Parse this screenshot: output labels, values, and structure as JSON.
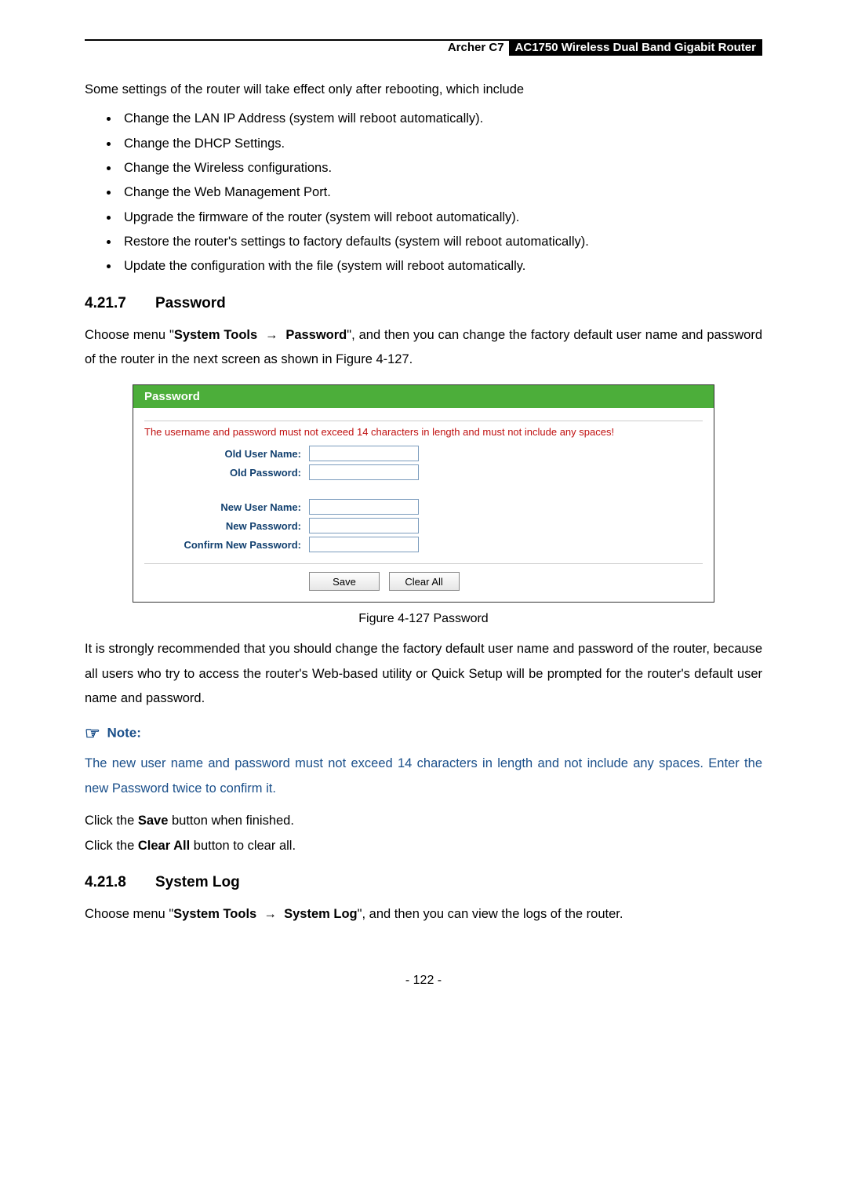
{
  "header": {
    "model": "Archer C7",
    "desc": "AC1750 Wireless Dual Band Gigabit Router"
  },
  "intro": "Some settings of the router will take effect only after rebooting, which include",
  "bullets": [
    "Change the LAN IP Address (system will reboot automatically).",
    "Change the DHCP Settings.",
    "Change the Wireless configurations.",
    "Change the Web Management Port.",
    "Upgrade the firmware of the router (system will reboot automatically).",
    "Restore the router's settings to factory defaults (system will reboot automatically).",
    "Update the configuration with the file (system will reboot automatically."
  ],
  "section1": {
    "num": "4.21.7",
    "title": "Password",
    "para_pre": "Choose menu \"",
    "para_bold1": "System Tools",
    "para_bold2": "Password",
    "para_post": "\", and then you can change the factory default user name and password of the router in the next screen as shown in Figure 4-127."
  },
  "figure": {
    "titlebar": "Password",
    "warning": "The username and password must not exceed 14 characters in length and must not include any spaces!",
    "labels": {
      "old_user": "Old User Name:",
      "old_pass": "Old Password:",
      "new_user": "New User Name:",
      "new_pass": "New Password:",
      "confirm": "Confirm New Password:"
    },
    "buttons": {
      "save": "Save",
      "clear": "Clear All"
    },
    "caption": "Figure 4-127 Password"
  },
  "para_after_figure": "It is strongly recommended that you should change the factory default user name and password of the router, because all users who try to access the router's Web-based utility or Quick Setup will be prompted for the router's default user name and password.",
  "note": {
    "heading": "Note:",
    "text": "The new user name and password must not exceed 14 characters in length and not include any spaces. Enter the new Password twice to confirm it."
  },
  "click_save_pre": "Click the ",
  "click_save_bold": "Save",
  "click_save_post": " button when finished.",
  "click_clear_pre": "Click the ",
  "click_clear_bold": "Clear All",
  "click_clear_post": " button to clear all.",
  "section2": {
    "num": "4.21.8",
    "title": "System Log",
    "para_pre": "Choose menu \"",
    "para_bold1": "System Tools",
    "para_bold2": "System Log",
    "para_post": "\", and then you can view the logs of the router."
  },
  "page_number": "- 122 -"
}
